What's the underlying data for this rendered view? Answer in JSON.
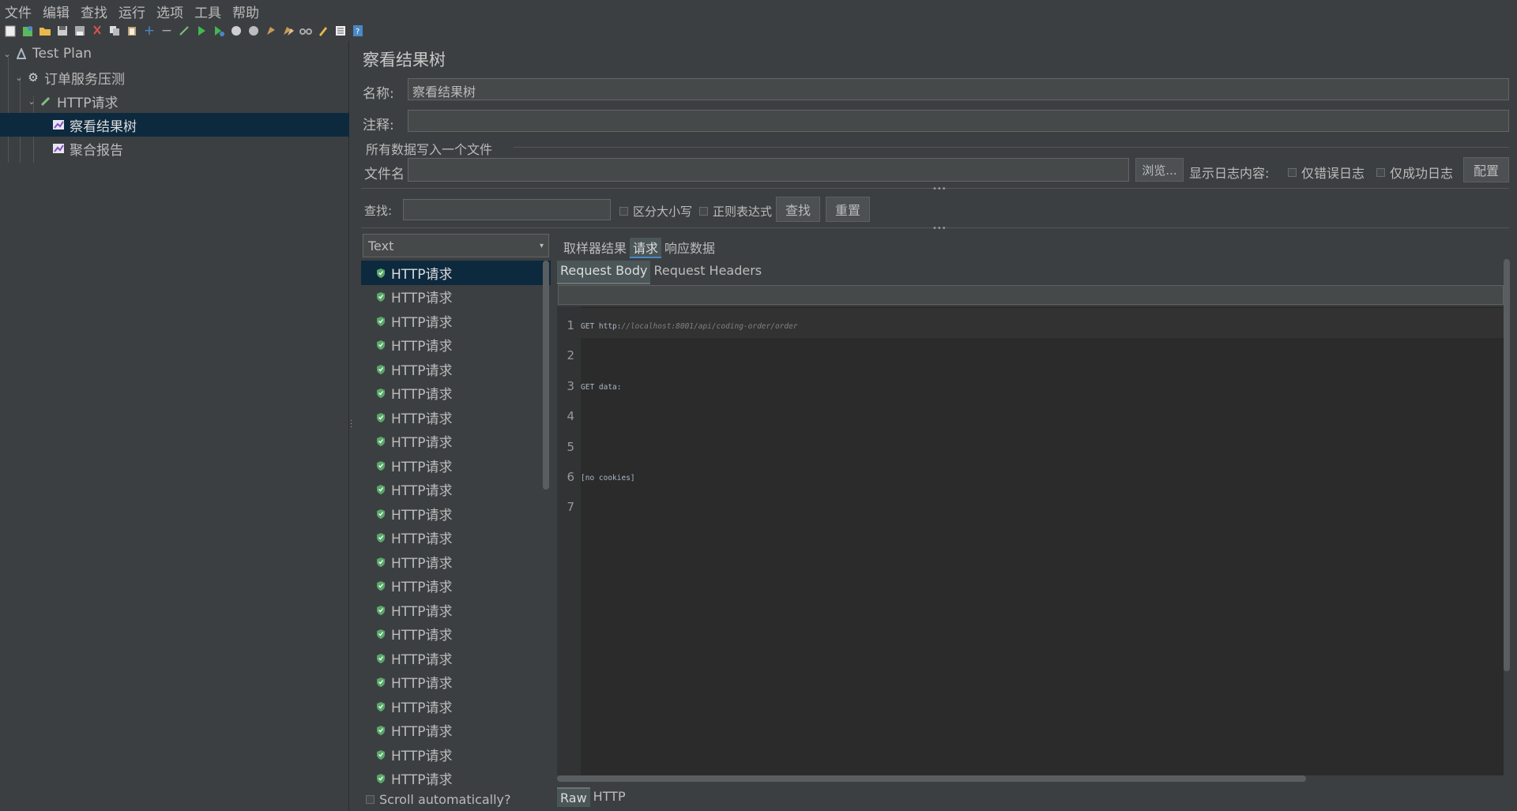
{
  "menu": [
    "文件",
    "编辑",
    "查找",
    "运行",
    "选项",
    "工具",
    "帮助"
  ],
  "toolbar_icons": [
    "new-icon",
    "templates-icon",
    "open-icon",
    "save-icon",
    "save-as-icon",
    "cut-icon",
    "copy-icon",
    "paste-icon",
    "expand-icon",
    "collapse-icon",
    "toggle-icon",
    "start-icon",
    "start-no-pause-icon",
    "stop-icon",
    "shutdown-icon",
    "clear-icon",
    "clear-all-icon",
    "search-icon",
    "reset-search-icon",
    "function-helper-icon",
    "help-icon"
  ],
  "tree": {
    "items": [
      {
        "label": "Test Plan",
        "icon": "test-plan-icon"
      },
      {
        "label": "订单服务压测",
        "icon": "gear-icon"
      },
      {
        "label": "HTTP请求",
        "icon": "pipette-icon"
      },
      {
        "label": "察看结果树",
        "icon": "chart-icon"
      },
      {
        "label": "聚合报告",
        "icon": "chart-icon"
      }
    ]
  },
  "panel": {
    "title": "察看结果树",
    "name_label": "名称:",
    "name_value": "察看结果树",
    "comment_label": "注释:",
    "comment_value": "",
    "file_section": "所有数据写入一个文件",
    "filename_label": "文件名",
    "filename_value": "",
    "browse": "浏览...",
    "log_label": "显示日志内容:",
    "errors_only": "仅错误日志",
    "success_only": "仅成功日志",
    "configure": "配置"
  },
  "search": {
    "label": "查找:",
    "value": "",
    "case_sensitive": "区分大小写",
    "regex": "正则表达式",
    "find": "查找",
    "reset": "重置"
  },
  "renderer": {
    "selected": "Text"
  },
  "results": {
    "items": [
      "HTTP请求",
      "HTTP请求",
      "HTTP请求",
      "HTTP请求",
      "HTTP请求",
      "HTTP请求",
      "HTTP请求",
      "HTTP请求",
      "HTTP请求",
      "HTTP请求",
      "HTTP请求",
      "HTTP请求",
      "HTTP请求",
      "HTTP请求",
      "HTTP请求",
      "HTTP请求",
      "HTTP请求",
      "HTTP请求",
      "HTTP请求",
      "HTTP请求",
      "HTTP请求",
      "HTTP请求"
    ],
    "scroll_auto": "Scroll automatically?"
  },
  "tabs": {
    "main": [
      "取样器结果",
      "请求",
      "响应数据"
    ],
    "sub": [
      "Request Body",
      "Request Headers"
    ],
    "bottom": [
      "Raw",
      "HTTP"
    ]
  },
  "editor": {
    "line_numbers": [
      "1",
      "2",
      "3",
      "4",
      "5",
      "6",
      "7"
    ],
    "line1_method": "GET ",
    "line1_scheme": "http:",
    "line1_url": "//localhost:8001/api/coding-order/order",
    "line3": "GET data:",
    "line6": "[no cookies]"
  },
  "colors": {
    "background": "#3c3f41",
    "selection": "#0d293e",
    "editor": "#2b2b2b",
    "accent": "#4a88c7",
    "success": "#59a869"
  }
}
